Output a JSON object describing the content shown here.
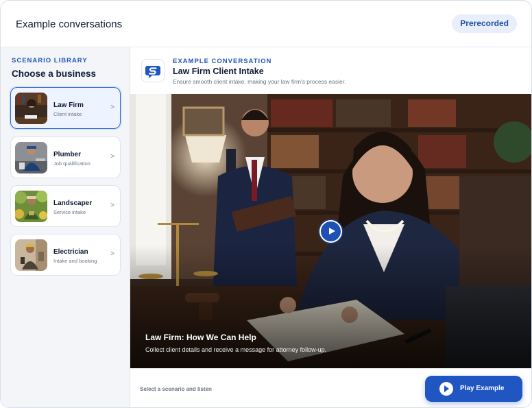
{
  "header": {
    "title": "Example conversations",
    "badge": "Prerecorded"
  },
  "sidebar": {
    "eyebrow": "SCENARIO LIBRARY",
    "title": "Choose a business",
    "items": [
      {
        "name": "Law Firm",
        "sub": "Client intake",
        "active": true
      },
      {
        "name": "Plumber",
        "sub": "Job qualification",
        "active": false
      },
      {
        "name": "Landscaper",
        "sub": "Service intake",
        "active": false
      },
      {
        "name": "Electrician",
        "sub": "Intake and booking",
        "active": false
      }
    ],
    "chevron": ">"
  },
  "main": {
    "eyebrow": "EXAMPLE CONVERSATION",
    "title": "Law Firm Client Intake",
    "description": "Ensure smooth client intake, making your law firm's process easier.",
    "caption_title": "Law Firm: How We Can Help",
    "caption_text": "Collect client details and receive a message for attorney follow-up."
  },
  "footer": {
    "hint": "Select a scenario and listen",
    "play_label": "Play Example"
  },
  "colors": {
    "accent": "#1f56c2",
    "eyebrow": "#1f57b8",
    "badge_bg": "#e8effa"
  }
}
